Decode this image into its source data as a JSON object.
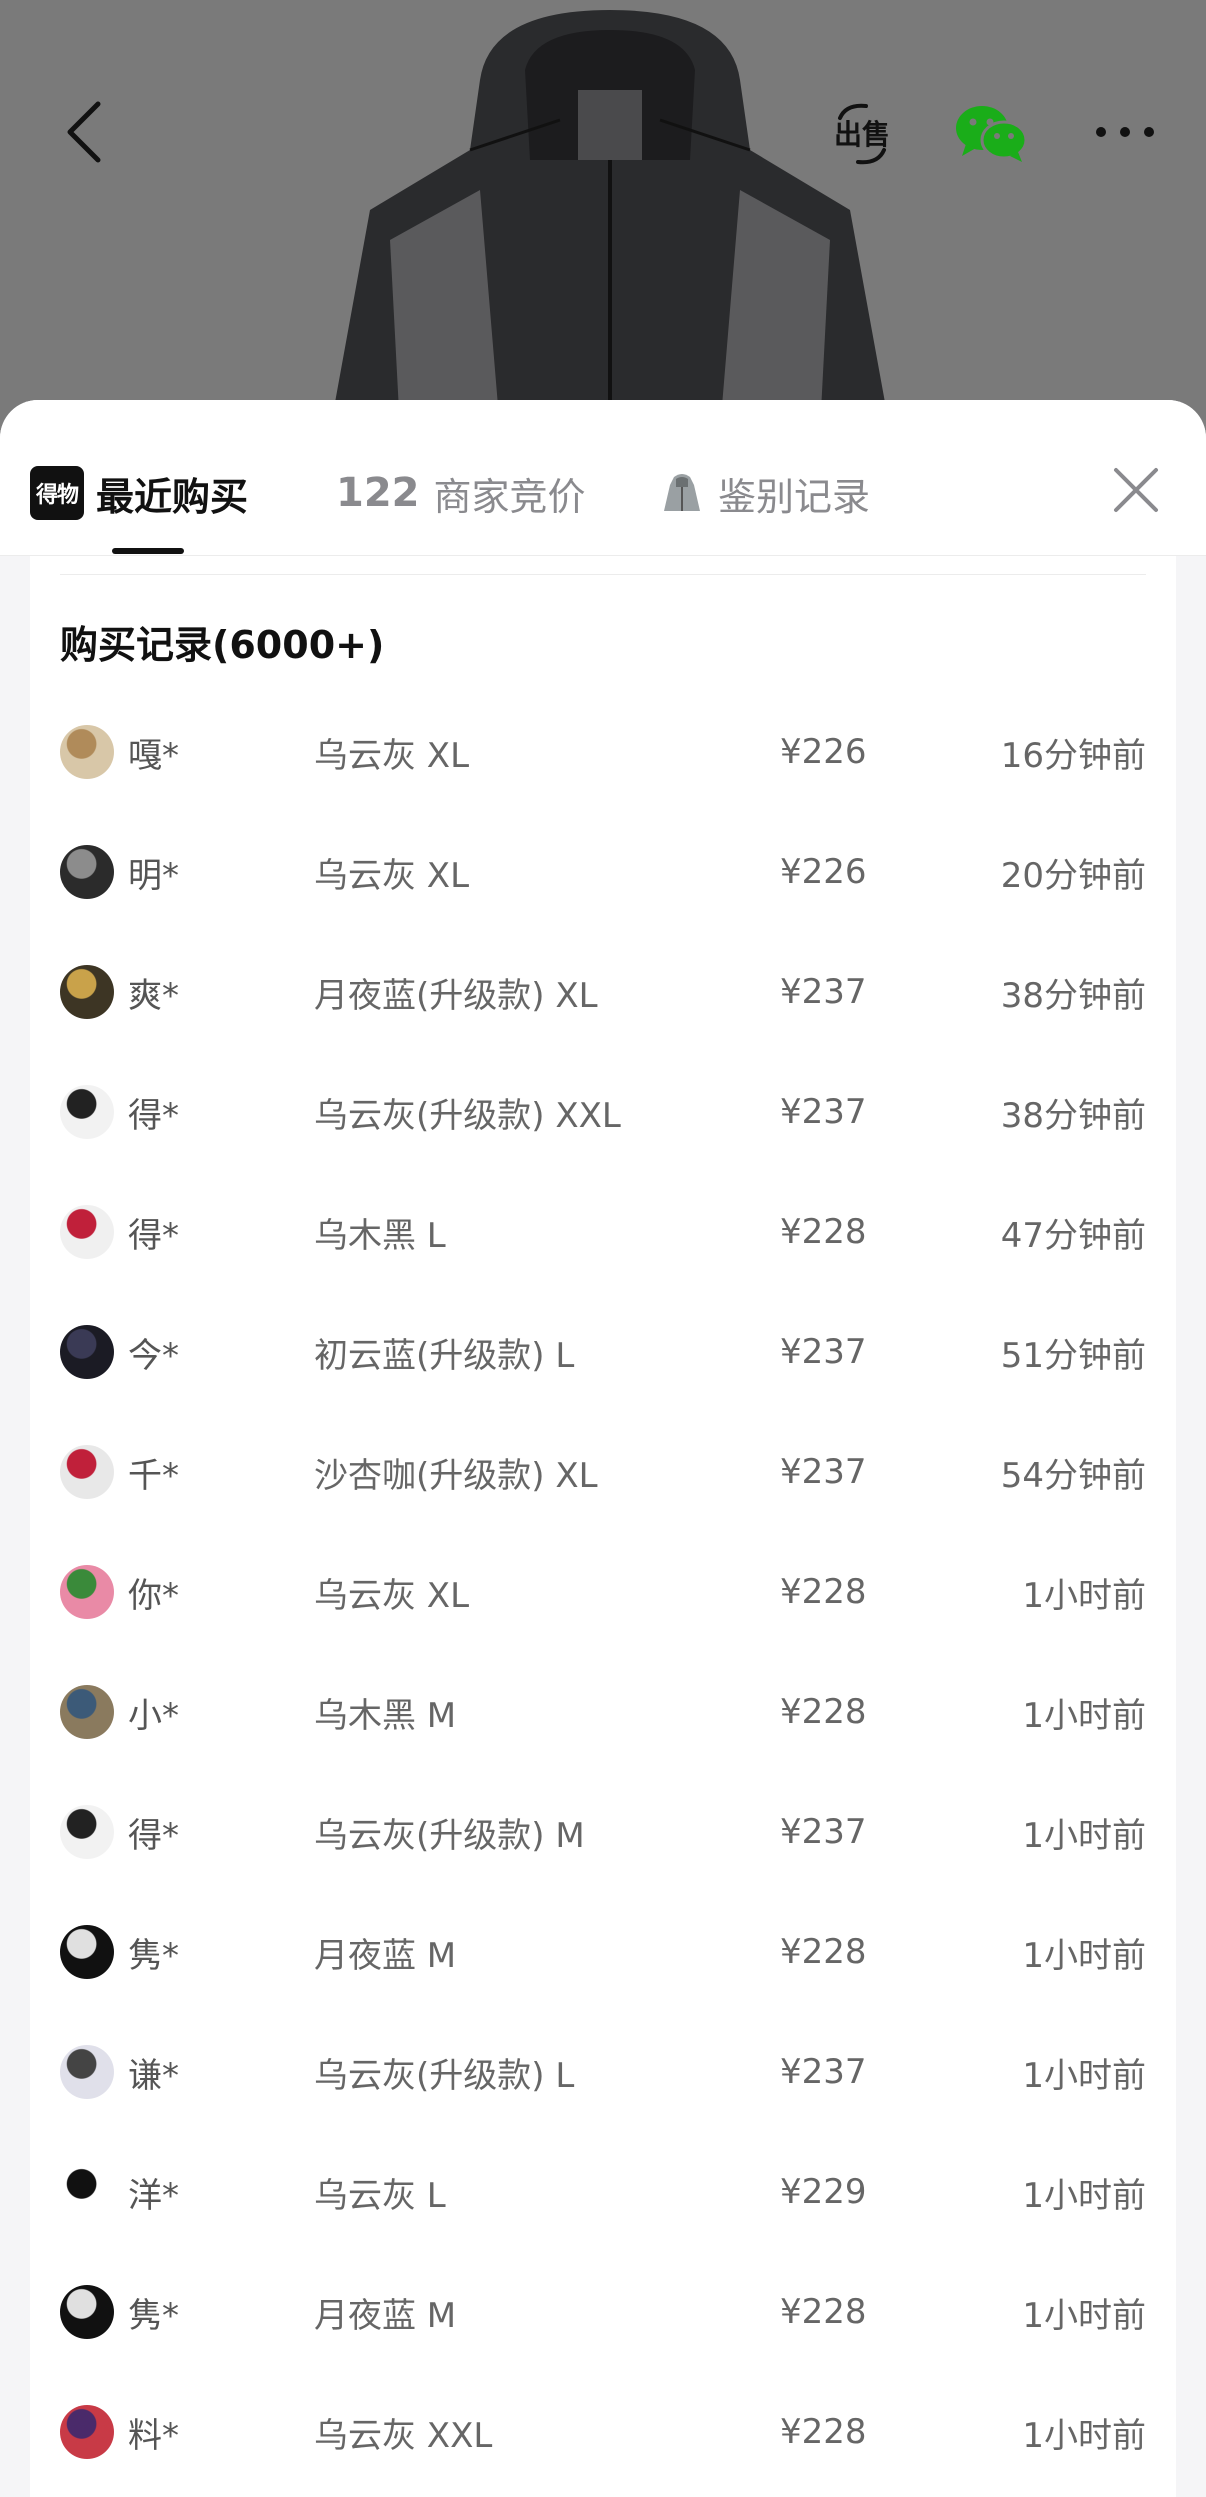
{
  "header": {
    "sell_label": "出售"
  },
  "tabs": {
    "brand_logo": "得物",
    "recent_label": "最近购买",
    "bids_count": "122",
    "bids_label": "商家竞价",
    "auth_label": "鉴别记录"
  },
  "records": {
    "title": "购买记录(6000+)",
    "rows": [
      {
        "user": "嘎*",
        "spec": "乌云灰 XL",
        "price": "¥226",
        "time": "16分钟前"
      },
      {
        "user": "明*",
        "spec": "乌云灰 XL",
        "price": "¥226",
        "time": "20分钟前"
      },
      {
        "user": "爽*",
        "spec": "月夜蓝(升级款) XL",
        "price": "¥237",
        "time": "38分钟前"
      },
      {
        "user": "得*",
        "spec": "乌云灰(升级款) XXL",
        "price": "¥237",
        "time": "38分钟前"
      },
      {
        "user": "得*",
        "spec": "乌木黑 L",
        "price": "¥228",
        "time": "47分钟前"
      },
      {
        "user": "今*",
        "spec": "初云蓝(升级款) L",
        "price": "¥237",
        "time": "51分钟前"
      },
      {
        "user": "千*",
        "spec": "沙杏咖(升级款) XL",
        "price": "¥237",
        "time": "54分钟前"
      },
      {
        "user": "你*",
        "spec": "乌云灰 XL",
        "price": "¥228",
        "time": "1小时前"
      },
      {
        "user": "小*",
        "spec": "乌木黑 M",
        "price": "¥228",
        "time": "1小时前"
      },
      {
        "user": "得*",
        "spec": "乌云灰(升级款) M",
        "price": "¥237",
        "time": "1小时前"
      },
      {
        "user": "隽*",
        "spec": "月夜蓝 M",
        "price": "¥228",
        "time": "1小时前"
      },
      {
        "user": "谦*",
        "spec": "乌云灰(升级款) L",
        "price": "¥237",
        "time": "1小时前"
      },
      {
        "user": "洋*",
        "spec": "乌云灰 L",
        "price": "¥229",
        "time": "1小时前"
      },
      {
        "user": "隽*",
        "spec": "月夜蓝 M",
        "price": "¥228",
        "time": "1小时前"
      },
      {
        "user": "料*",
        "spec": "乌云灰 XXL",
        "price": "¥228",
        "time": "1小时前"
      }
    ]
  },
  "icons": {
    "back": "back-arrow-icon",
    "wechat": "wechat-icon",
    "more": "more-icon",
    "close": "close-icon",
    "auth": "jacket-icon"
  },
  "colors": {
    "wechat_green": "#1aad19",
    "text_primary": "#111111",
    "text_secondary": "#666666",
    "tab_inactive": "#8a8a8e"
  }
}
